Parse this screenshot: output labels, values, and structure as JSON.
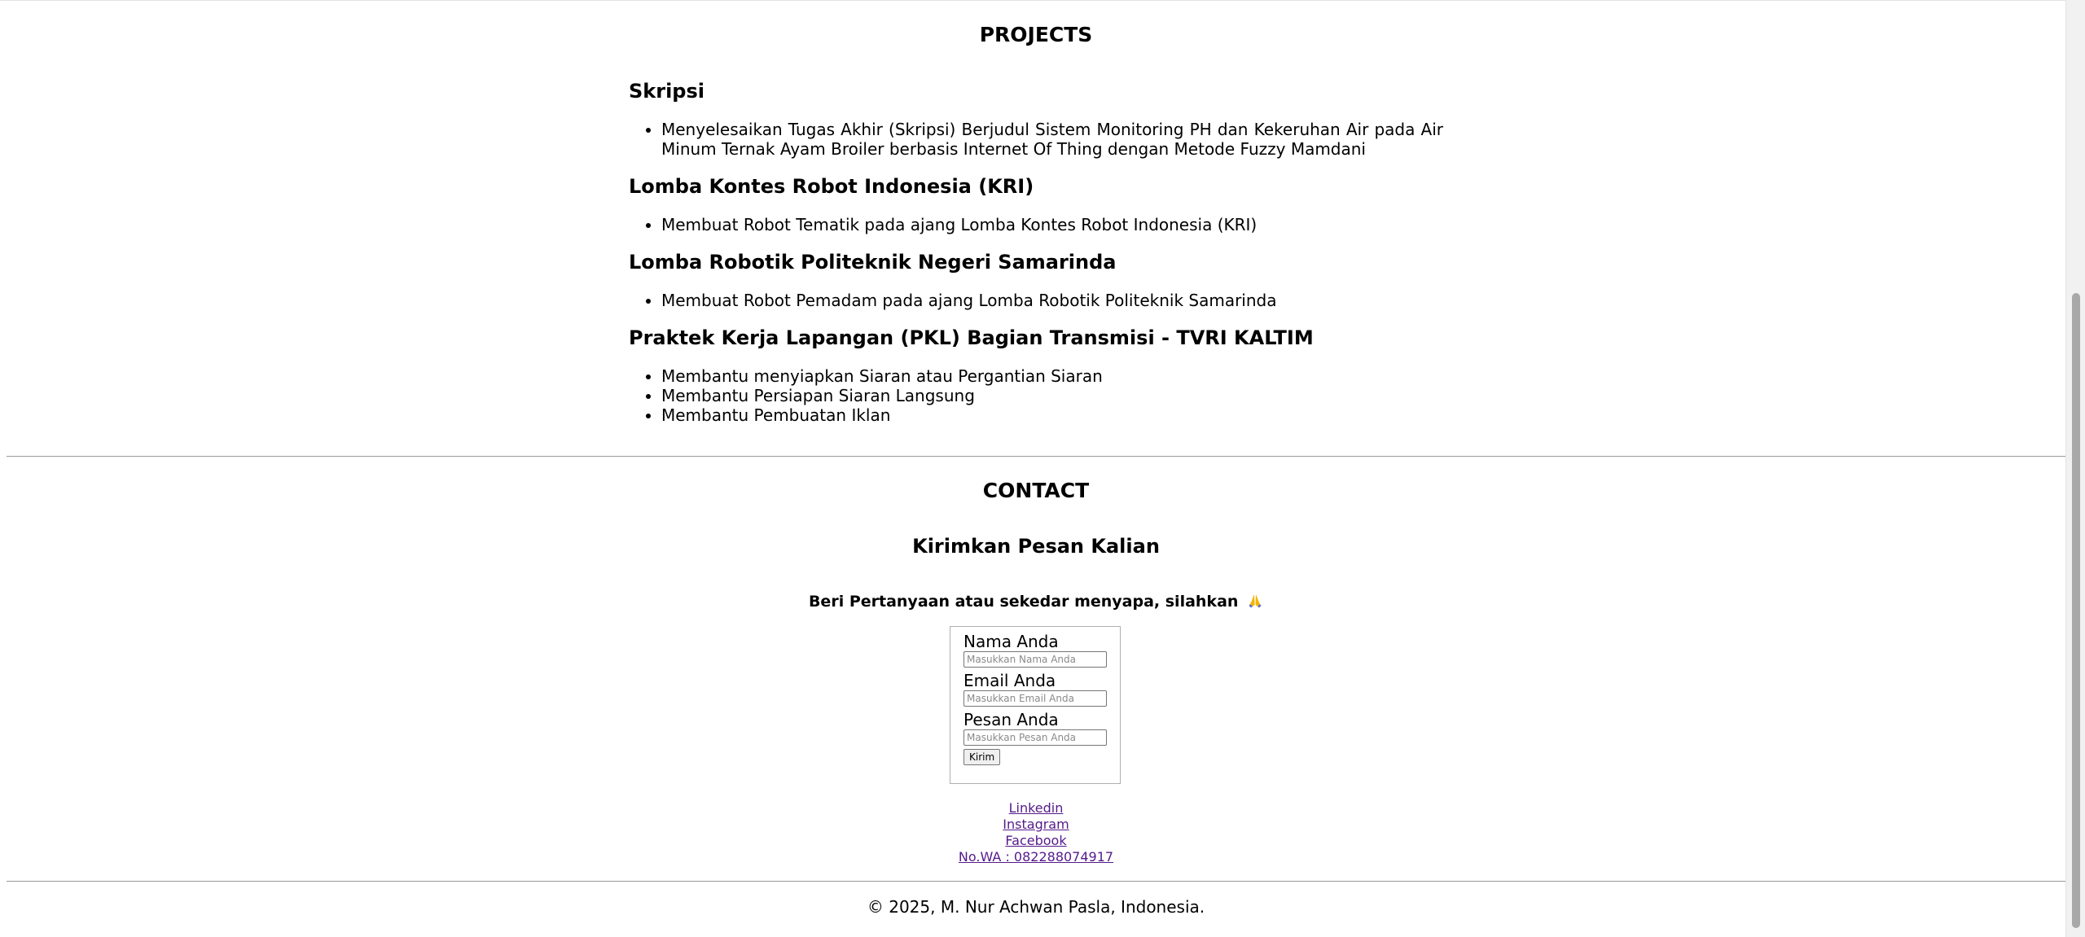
{
  "projects": {
    "heading": "PROJECTS",
    "items": [
      {
        "title": "Skripsi",
        "bullets": [
          "Menyelesaikan Tugas Akhir (Skripsi) Berjudul Sistem Monitoring PH dan Kekeruhan Air pada Air Minum Ternak Ayam Broiler berbasis Internet Of Thing dengan Metode Fuzzy Mamdani"
        ]
      },
      {
        "title": "Lomba Kontes Robot Indonesia (KRI)",
        "bullets": [
          "Membuat Robot Tematik pada ajang Lomba Kontes Robot Indonesia (KRI)"
        ]
      },
      {
        "title": "Lomba Robotik Politeknik Negeri Samarinda",
        "bullets": [
          "Membuat Robot Pemadam pada ajang Lomba Robotik Politeknik Samarinda"
        ]
      },
      {
        "title": "Praktek Kerja Lapangan (PKL) Bagian Transmisi - TVRI KALTIM",
        "bullets": [
          "Membantu menyiapkan Siaran atau Pergantian Siaran",
          "Membantu Persiapan Siaran Langsung",
          "Membantu Pembuatan Iklan"
        ]
      }
    ]
  },
  "contact": {
    "heading": "CONTACT",
    "subtitle": "Kirimkan Pesan Kalian",
    "intro": "Beri Pertanyaan atau sekedar menyapa, silahkan",
    "intro_icon": "folded-hands-icon",
    "form": {
      "name_label": "Nama Anda",
      "name_placeholder": "Masukkan Nama Anda",
      "email_label": "Email Anda",
      "email_placeholder": "Masukkan Email Anda",
      "message_label": "Pesan Anda",
      "message_placeholder": "Masukkan Pesan Anda",
      "submit_label": "Kirim"
    },
    "links": {
      "linkedin": "Linkedin",
      "instagram": "Instagram",
      "facebook": "Facebook",
      "whatsapp": "No.WA : 082288074917"
    }
  },
  "footer": {
    "copyright": "© 2025, M. Nur Achwan Pasla, Indonesia."
  },
  "colors": {
    "link_visited": "#551a8b",
    "divider": "#9a9a9a",
    "scrollbar_thumb": "#a8a8a8"
  }
}
